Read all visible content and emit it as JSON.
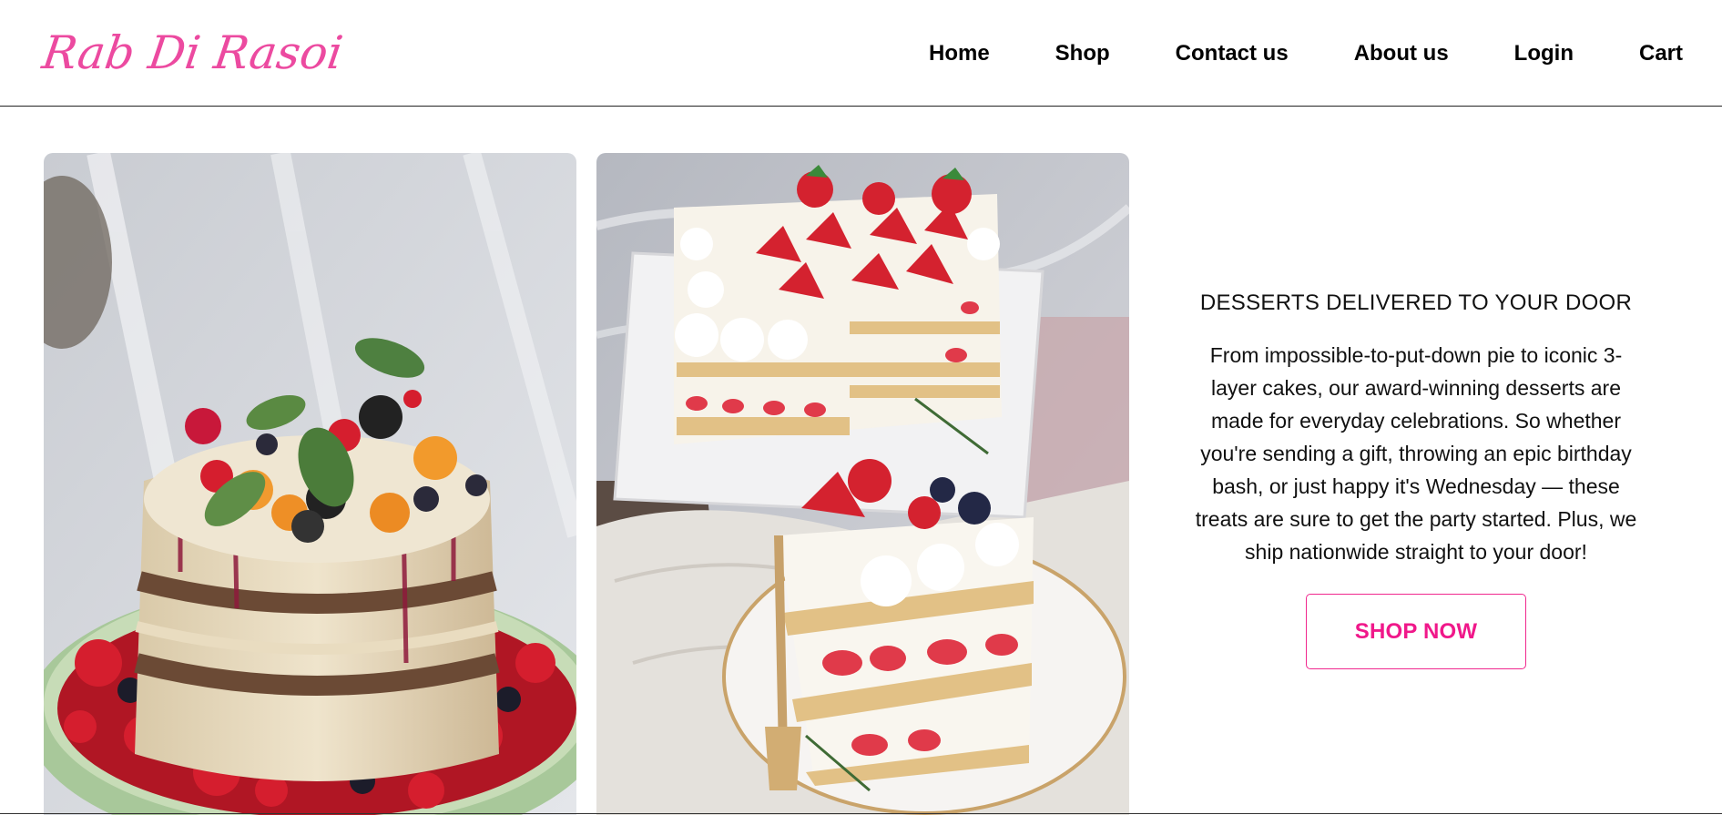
{
  "brand": {
    "name": "Rab Di Rasoi",
    "color": "#ec4aa0"
  },
  "nav": {
    "items": [
      {
        "label": "Home"
      },
      {
        "label": "Shop"
      },
      {
        "label": "Contact us"
      },
      {
        "label": "About us"
      },
      {
        "label": "Login"
      },
      {
        "label": "Cart"
      }
    ]
  },
  "hero": {
    "images": [
      {
        "icon": "naked-fruit-cake-image"
      },
      {
        "icon": "strawberry-shortcake-image"
      }
    ],
    "heading": "DESSERTS DELIVERED TO YOUR DOOR",
    "body": "From impossible-to-put-down pie to iconic 3-layer cakes, our award-winning desserts are made for everyday celebrations. So whether you're sending a gift, throwing an epic birthday bash, or just happy it's Wednesday — these treats are sure to get the party started. Plus, we ship nationwide straight to your door!",
    "cta_label": "SHOP NOW",
    "accent": "#f0188a"
  }
}
